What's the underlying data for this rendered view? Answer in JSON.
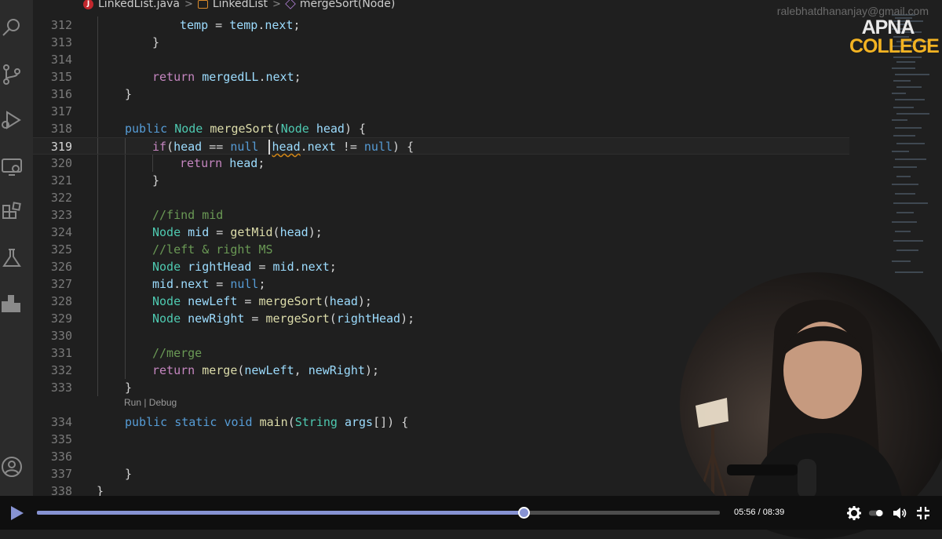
{
  "breadcrumb": {
    "file": "LinkedList.java",
    "class": "LinkedList",
    "method": "mergeSort(Node)"
  },
  "overlay": {
    "email": "ralebhatdhananjay@gmail.com",
    "logo_line1": "APNA",
    "logo_line2": "COLLEGE"
  },
  "codelens": "Run | Debug",
  "lines": [
    {
      "n": "312"
    },
    {
      "n": "313"
    },
    {
      "n": "314"
    },
    {
      "n": "315"
    },
    {
      "n": "316"
    },
    {
      "n": "317"
    },
    {
      "n": "318"
    },
    {
      "n": "319"
    },
    {
      "n": "320"
    },
    {
      "n": "321"
    },
    {
      "n": "322"
    },
    {
      "n": "323"
    },
    {
      "n": "324"
    },
    {
      "n": "325"
    },
    {
      "n": "326"
    },
    {
      "n": "327"
    },
    {
      "n": "328"
    },
    {
      "n": "329"
    },
    {
      "n": "330"
    },
    {
      "n": "331"
    },
    {
      "n": "332"
    },
    {
      "n": "333"
    },
    {
      "n": "334"
    },
    {
      "n": "335"
    },
    {
      "n": "336"
    },
    {
      "n": "337"
    },
    {
      "n": "338"
    }
  ],
  "tokens": {
    "l312": [
      "temp",
      " = ",
      "temp",
      ".",
      "next",
      ";"
    ],
    "l313": "}",
    "l315": [
      "return",
      " ",
      "mergedLL",
      ".",
      "next",
      ";"
    ],
    "l316": "}",
    "l318": [
      "public",
      " ",
      "Node",
      " ",
      "mergeSort",
      "(",
      "Node",
      " ",
      "head",
      ") {"
    ],
    "l319": [
      "if",
      "(",
      "head",
      " == ",
      "null",
      " ",
      "head",
      ".",
      "next",
      " != ",
      "null",
      ") {"
    ],
    "l320": [
      "return",
      " ",
      "head",
      ";"
    ],
    "l321": "}",
    "l323": "//find mid",
    "l324": [
      "Node",
      " ",
      "mid",
      " = ",
      "getMid",
      "(",
      "head",
      ");"
    ],
    "l325": "//left & right MS",
    "l326": [
      "Node",
      " ",
      "rightHead",
      " = ",
      "mid",
      ".",
      "next",
      ";"
    ],
    "l327": [
      "mid",
      ".",
      "next",
      " = ",
      "null",
      ";"
    ],
    "l328": [
      "Node",
      " ",
      "newLeft",
      " = ",
      "mergeSort",
      "(",
      "head",
      ");"
    ],
    "l329": [
      "Node",
      " ",
      "newRight",
      " = ",
      "mergeSort",
      "(",
      "rightHead",
      ");"
    ],
    "l331": "//merge",
    "l332": [
      "return",
      " ",
      "merge",
      "(",
      "newLeft",
      ", ",
      "newRight",
      ");"
    ],
    "l333": "}",
    "l334": [
      "public",
      " ",
      "static",
      " ",
      "void",
      " ",
      "main",
      "(",
      "String",
      " ",
      "args",
      "[]) {"
    ],
    "l337": "}",
    "l338": "}"
  },
  "player": {
    "current_time": "05:56",
    "total_time": "08:39",
    "time_separator": " / ",
    "progress": 0.7125
  },
  "icons": [
    "search-icon",
    "source-control-icon",
    "run-debug-icon",
    "remote-explorer-icon",
    "extensions-icon",
    "testing-icon",
    "charts-icon",
    "account-icon",
    "play-icon",
    "settings-icon",
    "autoplay-toggle-icon",
    "volume-icon",
    "fullscreen-icon"
  ]
}
